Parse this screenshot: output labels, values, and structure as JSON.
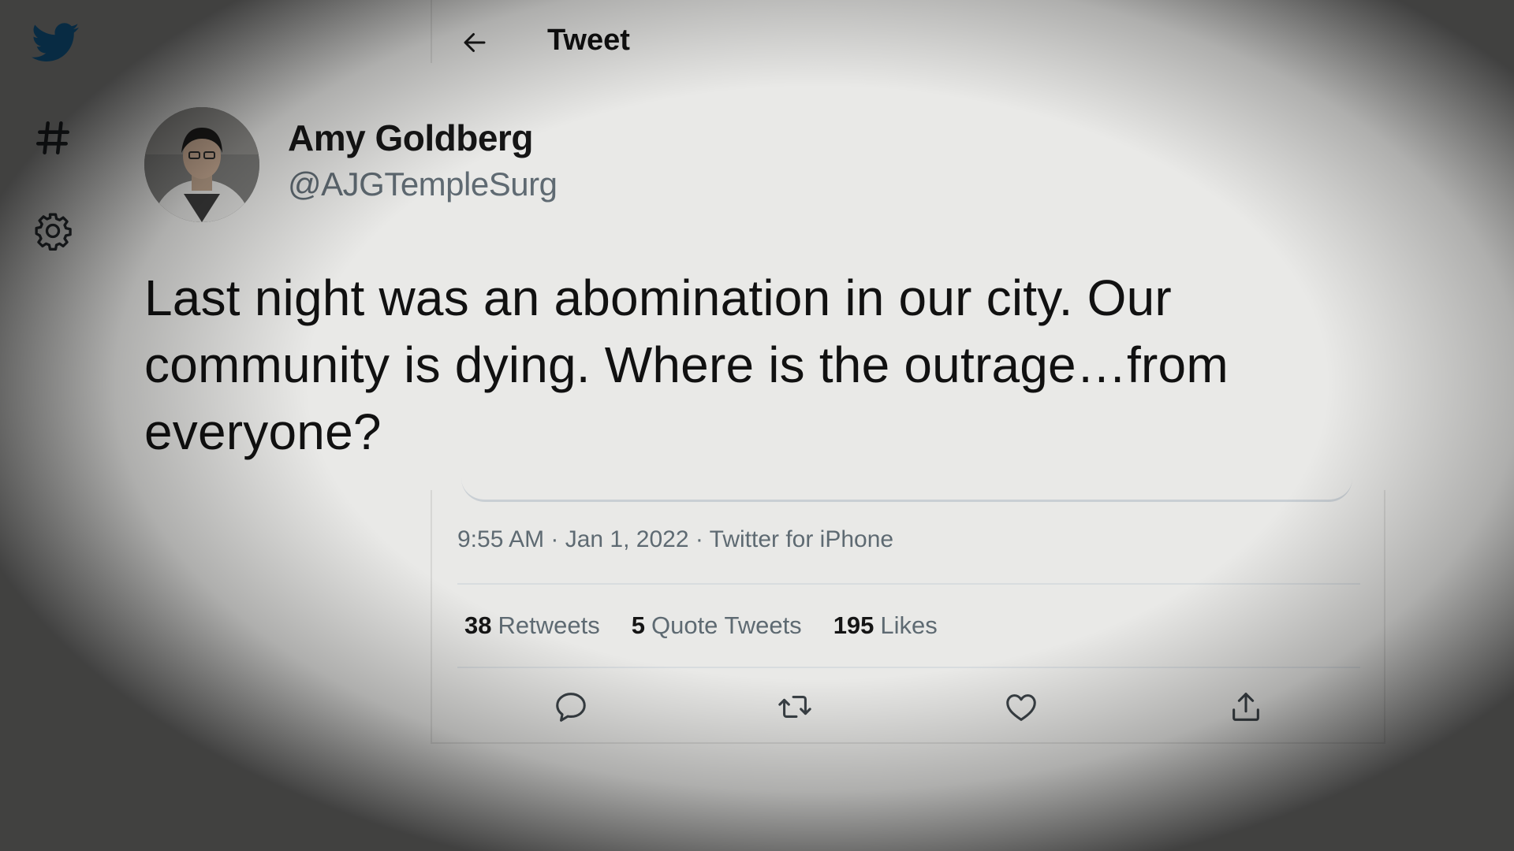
{
  "header": {
    "title": "Tweet",
    "back_icon": "arrow-left-icon"
  },
  "sidebar": {
    "items": [
      {
        "icon": "twitter-bird-icon",
        "color": "#1d9bf0"
      },
      {
        "icon": "hashtag-icon"
      },
      {
        "icon": "gear-icon"
      }
    ]
  },
  "tweet": {
    "author_name": "Amy Goldberg",
    "author_handle": "@AJGTempleSurg",
    "text": "Last night was an abomination in our city. Our community is dying. Where is the outrage…from everyone?",
    "meta": "9:55 AM · Jan 1, 2022 · Twitter for iPhone",
    "stats": [
      {
        "count": "38",
        "label": "Retweets"
      },
      {
        "count": "5",
        "label": "Quote Tweets"
      },
      {
        "count": "195",
        "label": "Likes"
      }
    ],
    "actions": [
      {
        "icon": "reply-icon"
      },
      {
        "icon": "retweet-icon"
      },
      {
        "icon": "like-icon"
      },
      {
        "icon": "share-icon"
      }
    ]
  },
  "colors": {
    "brand": "#1d9bf0",
    "background": "#e9e9e7",
    "secondary_text": "#5e6a72"
  }
}
